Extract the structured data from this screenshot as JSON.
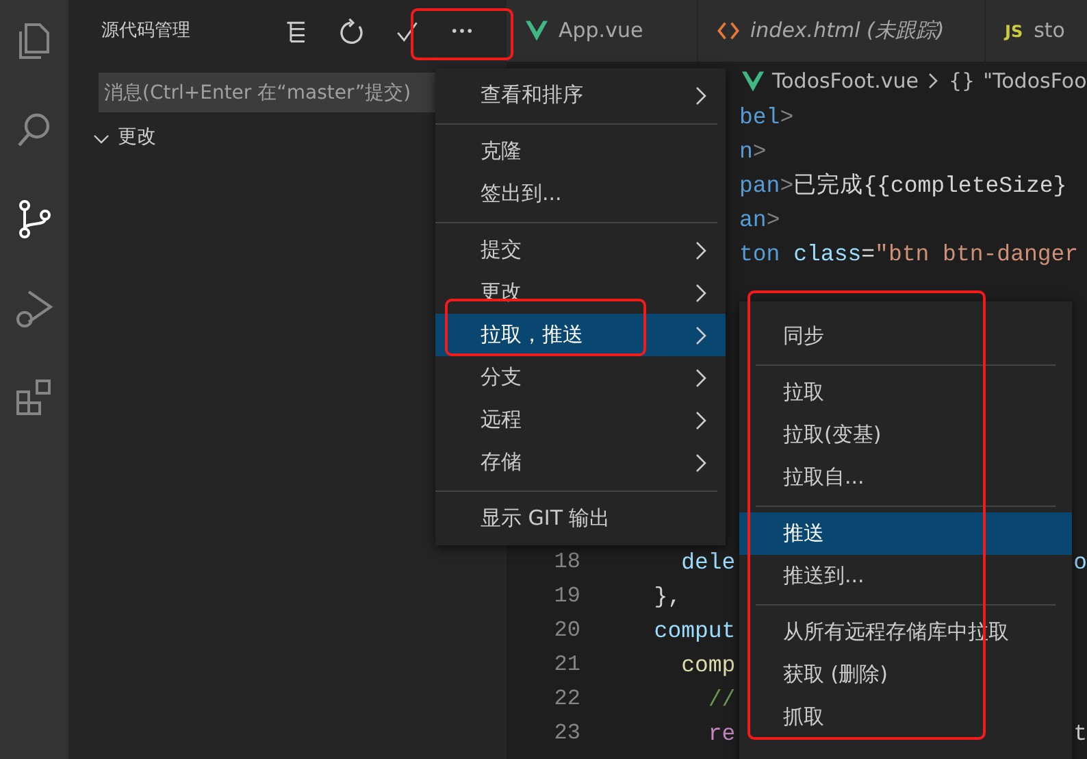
{
  "activity_bar": {
    "items": [
      {
        "kind": "files",
        "selected": false
      },
      {
        "kind": "search",
        "selected": false
      },
      {
        "kind": "source-control",
        "selected": true
      },
      {
        "kind": "run",
        "selected": false
      },
      {
        "kind": "extensions",
        "selected": false
      }
    ]
  },
  "sidebar": {
    "title": "源代码管理",
    "actions": [
      {
        "kind": "tree"
      },
      {
        "kind": "refresh"
      },
      {
        "kind": "commit"
      },
      {
        "kind": "more",
        "annotated": true
      }
    ],
    "message_input": {
      "placeholder": "消息(Ctrl+Enter 在“master”提交)"
    },
    "sections": [
      {
        "label": "更改",
        "expanded": true
      }
    ]
  },
  "tabs": [
    {
      "label": "App.vue",
      "kind": "vue",
      "italic": false
    },
    {
      "label": "index.html (未跟踪)",
      "kind": "html",
      "italic": true
    },
    {
      "label": "sto",
      "kind": "js",
      "icon_text": "JS",
      "italic": false
    }
  ],
  "breadcrumb": {
    "file": "TodosFoot.vue",
    "symbol_glyph": "{}",
    "symbol": "\"TodosFoo"
  },
  "code_top": [
    [
      {
        "text": "bel",
        "kind": "tag"
      },
      {
        "text": ">",
        "kind": "punct"
      }
    ],
    [
      {
        "text": "n",
        "kind": "tag"
      },
      {
        "text": ">",
        "kind": "punct"
      }
    ],
    [
      {
        "text": "pan",
        "kind": "tag"
      },
      {
        "text": ">",
        "kind": "punct"
      },
      {
        "text": "已完成{{completeSize}",
        "kind": "plain"
      }
    ],
    [
      {
        "text": "an",
        "kind": "tag"
      },
      {
        "text": ">",
        "kind": "punct"
      }
    ],
    [
      {
        "text": "ton",
        "kind": "tag"
      },
      {
        "text": " class",
        "kind": "attr"
      },
      {
        "text": "=",
        "kind": "plain"
      },
      {
        "text": "\"btn btn-danger",
        "kind": "string"
      }
    ]
  ],
  "code_bottom": [
    {
      "number": "18",
      "code": [
        {
          "text": "    dele",
          "kind": "prop"
        }
      ],
      "tail": [
        {
          "text": "o",
          "kind": "prop"
        }
      ]
    },
    {
      "number": "19",
      "code": [
        {
          "text": "  },",
          "kind": "plain"
        }
      ]
    },
    {
      "number": "20",
      "code": [
        {
          "text": "  comput",
          "kind": "prop"
        }
      ]
    },
    {
      "number": "21",
      "code": [
        {
          "text": "    comp",
          "kind": "func"
        }
      ]
    },
    {
      "number": "22",
      "code": [
        {
          "text": "      //",
          "kind": "comment"
        }
      ]
    },
    {
      "number": "23",
      "code": [
        {
          "text": "      re",
          "kind": "keyword"
        }
      ],
      "tail": [
        {
          "text": "t",
          "kind": "plain"
        }
      ]
    }
  ],
  "menu": {
    "items": [
      {
        "kind": "item",
        "label": "查看和排序",
        "submenu": true,
        "selected": false,
        "annotated": false
      },
      {
        "kind": "separator"
      },
      {
        "kind": "item",
        "label": "克隆",
        "submenu": false,
        "selected": false,
        "annotated": false
      },
      {
        "kind": "item",
        "label": "签出到...",
        "submenu": false,
        "selected": false,
        "annotated": false
      },
      {
        "kind": "separator"
      },
      {
        "kind": "item",
        "label": "提交",
        "submenu": true,
        "selected": false,
        "annotated": false
      },
      {
        "kind": "item",
        "label": "更改",
        "submenu": true,
        "selected": false,
        "annotated": false
      },
      {
        "kind": "item",
        "label": "拉取，推送",
        "submenu": true,
        "selected": true,
        "annotated": true
      },
      {
        "kind": "item",
        "label": "分支",
        "submenu": true,
        "selected": false,
        "annotated": false
      },
      {
        "kind": "item",
        "label": "远程",
        "submenu": true,
        "selected": false,
        "annotated": false
      },
      {
        "kind": "item",
        "label": "存储",
        "submenu": true,
        "selected": false,
        "annotated": false
      },
      {
        "kind": "separator"
      },
      {
        "kind": "item",
        "label": "显示 GIT 输出",
        "submenu": false,
        "selected": false,
        "annotated": false
      }
    ]
  },
  "submenu": {
    "annotated": true,
    "items": [
      {
        "kind": "item",
        "label": "同步",
        "selected": false
      },
      {
        "kind": "separator"
      },
      {
        "kind": "item",
        "label": "拉取",
        "selected": false
      },
      {
        "kind": "item",
        "label": "拉取(变基)",
        "selected": false
      },
      {
        "kind": "item",
        "label": "拉取自...",
        "selected": false
      },
      {
        "kind": "separator"
      },
      {
        "kind": "item",
        "label": "推送",
        "selected": true
      },
      {
        "kind": "item",
        "label": "推送到...",
        "selected": false
      },
      {
        "kind": "separator"
      },
      {
        "kind": "item",
        "label": "从所有远程存储库中拉取",
        "selected": false
      },
      {
        "kind": "item",
        "label": "获取 (删除)",
        "selected": false
      },
      {
        "kind": "item",
        "label": "抓取",
        "selected": false
      }
    ]
  }
}
